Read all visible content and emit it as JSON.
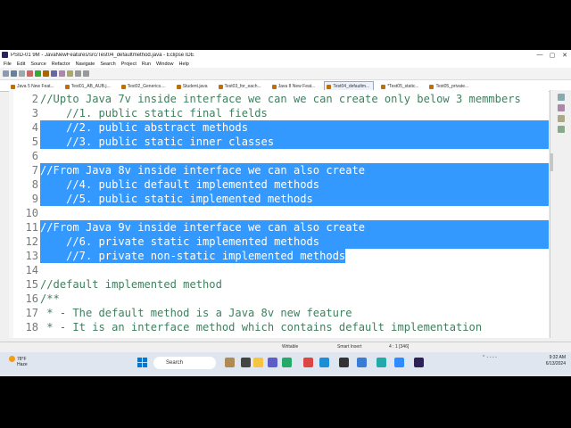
{
  "window": {
    "title": "PSID-01 9M - JavaNewFeatures/src/Test04_defaultmethod.java - Eclipse IDE",
    "minimize": "—",
    "maximize": "▢",
    "close": "✕"
  },
  "menu": [
    "File",
    "Edit",
    "Source",
    "Refactor",
    "Navigate",
    "Search",
    "Project",
    "Run",
    "Window",
    "Help"
  ],
  "tabs": [
    {
      "label": "Java 5 New Feat...",
      "active": false
    },
    {
      "label": "Test01_AB_AUB.j...",
      "active": false
    },
    {
      "label": "Test02_Generics....",
      "active": false
    },
    {
      "label": "Student.java",
      "active": false
    },
    {
      "label": "Test03_for_each...",
      "active": false
    },
    {
      "label": "Java 8 New Feat...",
      "active": false
    },
    {
      "label": "Test04_defaultm...",
      "active": true
    },
    {
      "label": "*Test05_static...",
      "active": false
    },
    {
      "label": "Test05_private...",
      "active": false
    }
  ],
  "code_lines": [
    {
      "num": "2",
      "text": "//Upto Java 7v inside interface we can we can create only below 3 memmbers",
      "sel": "none"
    },
    {
      "num": "3",
      "text": "    //1. public static final fields",
      "sel": "none"
    },
    {
      "num": "4",
      "text": "    //2. public abstract methods",
      "sel": "full"
    },
    {
      "num": "5",
      "text": "    //3. public static inner classes",
      "sel": "full"
    },
    {
      "num": "6",
      "text": "",
      "sel": "full"
    },
    {
      "num": "7",
      "text": "//From Java 8v inside interface we can also create",
      "sel": "full"
    },
    {
      "num": "8",
      "text": "    //4. public default implemented methods",
      "sel": "full"
    },
    {
      "num": "9",
      "text": "    //5. public static implemented methods",
      "sel": "full"
    },
    {
      "num": "10",
      "text": "",
      "sel": "full"
    },
    {
      "num": "11",
      "text": "//From Java 9v inside interface we can also create",
      "sel": "full"
    },
    {
      "num": "12",
      "text": "    //6. private static implemented methods",
      "sel": "full"
    },
    {
      "num": "13",
      "text": "    //7. private non-static implemented methods",
      "sel": "text"
    },
    {
      "num": "14",
      "text": "",
      "sel": "none"
    },
    {
      "num": "15",
      "text": "//default implemented method",
      "sel": "none"
    },
    {
      "num": "16",
      "text": "/**",
      "sel": "none"
    },
    {
      "num": "17",
      "text": " * - The default method is a Java 8v new feature",
      "sel": "none"
    },
    {
      "num": "18",
      "text": " * - It is an interface method which contains default implementation",
      "sel": "none"
    }
  ],
  "status": {
    "writable": "Writable",
    "insert_mode": "Smart Insert",
    "position": "4 : 1 [346]"
  },
  "taskbar": {
    "temp": "78°F",
    "weather": "Haze",
    "search_label": "Search",
    "time": "9:32 AM",
    "date": "6/13/2024"
  },
  "colors": {
    "selection": "#3399ff",
    "comment": "#3f7f5f",
    "line_number": "#787878"
  }
}
